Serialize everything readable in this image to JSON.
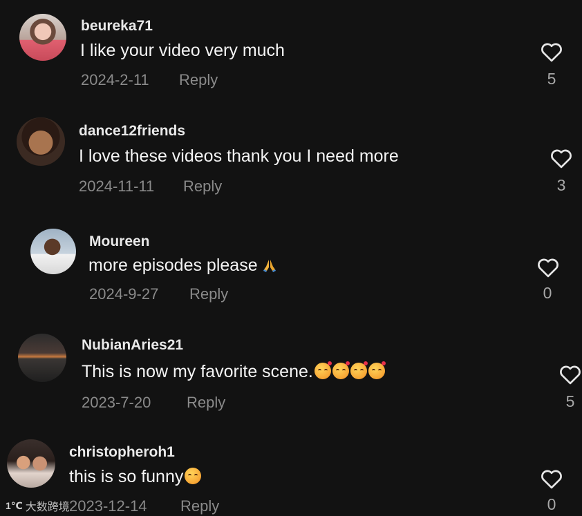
{
  "comments": [
    {
      "username": "beureka71",
      "text": "I like your video very much",
      "date": "2024-2-11",
      "reply_label": "Reply",
      "likes": "5"
    },
    {
      "username": "dance12friends",
      "text": "I love these videos thank you I need more",
      "date": "2024-11-11",
      "reply_label": "Reply",
      "likes": "3"
    },
    {
      "username": "Moureen",
      "text": "more episodes please",
      "date": "2024-9-27",
      "reply_label": "Reply",
      "likes": "0"
    },
    {
      "username": "NubianAries21",
      "text": "This is now my favorite scene.",
      "date": "2023-7-20",
      "reply_label": "Reply",
      "likes": "5"
    },
    {
      "username": "christopheroh1",
      "text": "this is so funny",
      "date": "2023-12-14",
      "reply_label": "Reply",
      "likes": "0"
    }
  ],
  "icons": {
    "like": "heart-outline-icon",
    "avatar": "avatar-photo"
  },
  "watermark": {
    "logo": "1℃",
    "text": "大数跨境"
  },
  "colors": {
    "background": "#121212",
    "text": "#f4f4f4",
    "muted": "#8a8a8a"
  }
}
